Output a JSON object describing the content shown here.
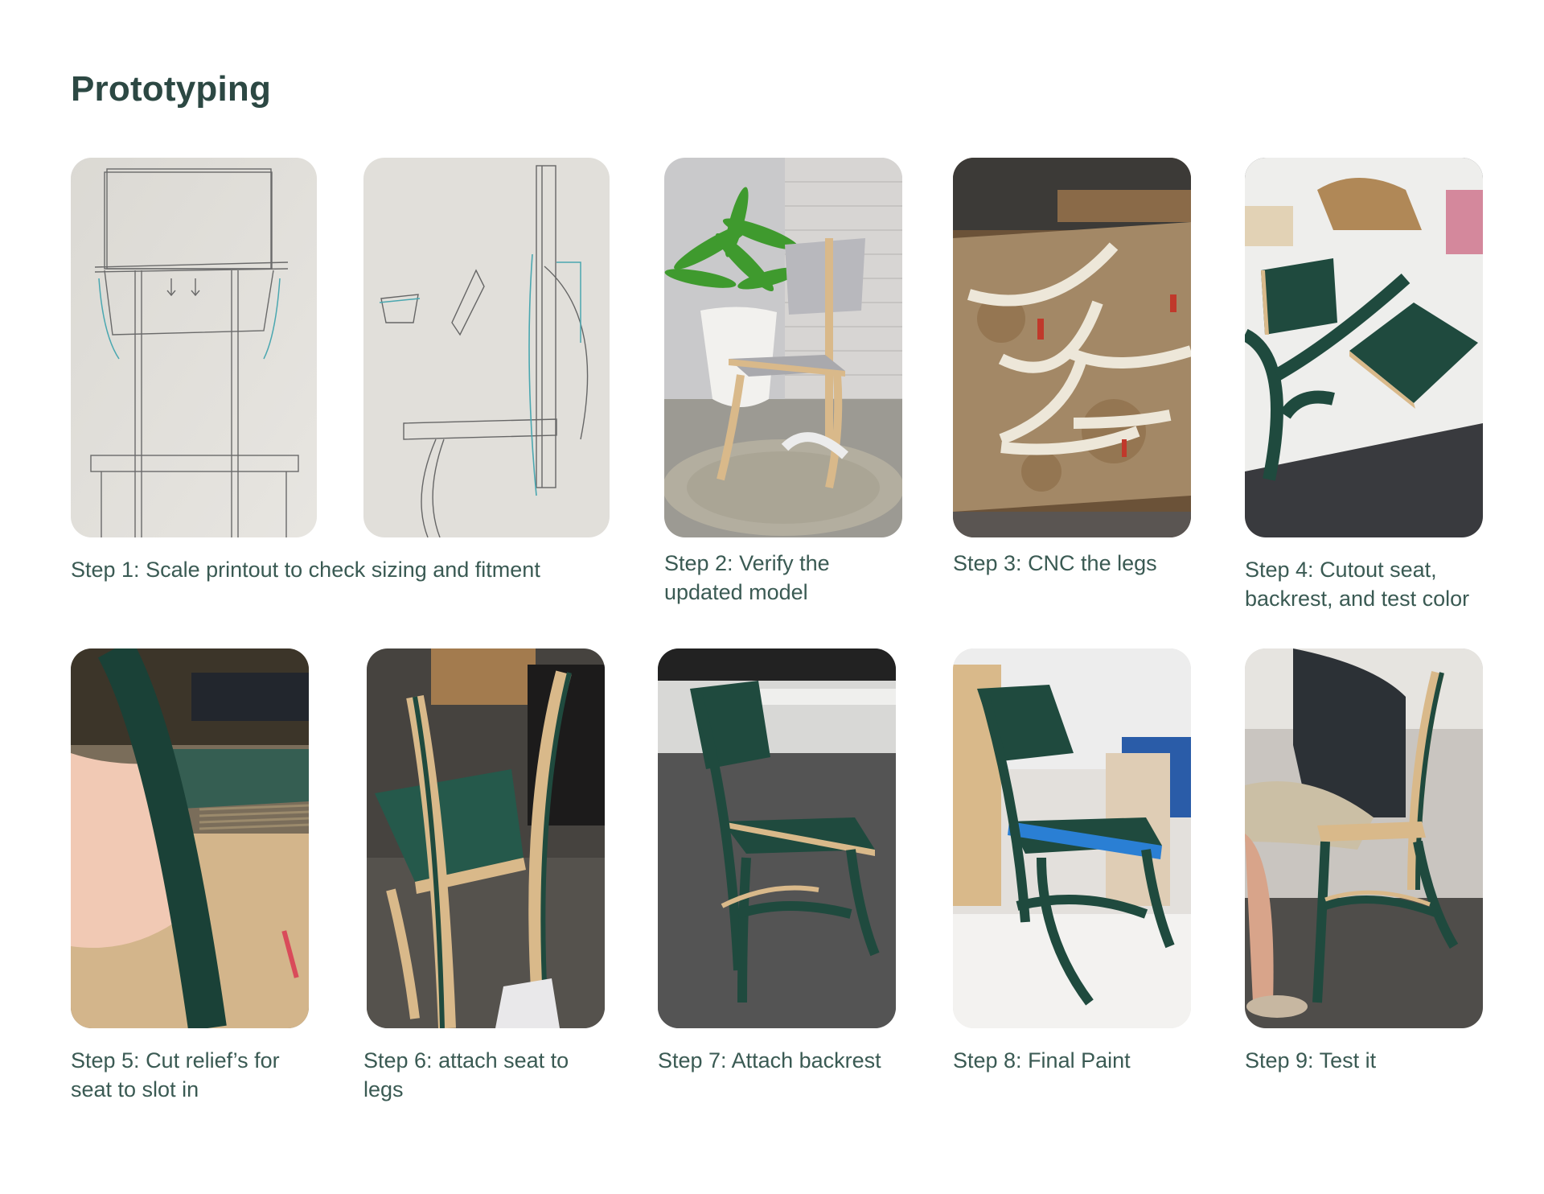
{
  "title": "Prototyping",
  "colors": {
    "title": "#2c4843",
    "caption": "#3a5a53",
    "chair_green": "#1f4a3e",
    "plywood": "#d9b98a"
  },
  "steps": [
    {
      "label": "Step 1: Scale printout to check sizing and fitment",
      "images": [
        "sketch-front-view",
        "sketch-side-view"
      ]
    },
    {
      "label": "Step 2: Verify the updated model",
      "images": [
        "3d-render-chair-with-plant"
      ]
    },
    {
      "label": "Step 3: CNC the legs",
      "images": [
        "cnc-cut-legs-on-workbench"
      ]
    },
    {
      "label": "Step 4: Cutout seat, backrest, and test color",
      "images": [
        "painted-seat-and-backrest-parts"
      ]
    },
    {
      "label": "Step 5: Cut relief’s for seat to slot in",
      "images": [
        "seat-slot-closeup"
      ]
    },
    {
      "label": "Step 6: attach seat to legs",
      "images": [
        "seat-attached-to-legs"
      ]
    },
    {
      "label": "Step 7: Attach backrest",
      "images": [
        "chair-with-backrest-in-studio"
      ]
    },
    {
      "label": "Step 8: Final Paint",
      "images": [
        "final-painted-chair"
      ]
    },
    {
      "label": "Step 9: Test it",
      "images": [
        "person-sitting-on-chair"
      ]
    }
  ]
}
